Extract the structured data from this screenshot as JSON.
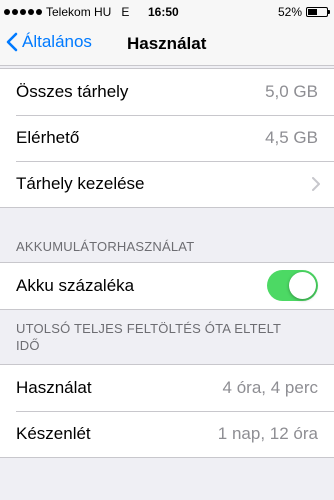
{
  "status_bar": {
    "carrier": "Telekom HU",
    "network": "E",
    "time": "16:50",
    "battery_percent": "52%",
    "battery_level": 0.52
  },
  "nav": {
    "back_label": "Általános",
    "title": "Használat"
  },
  "storage": {
    "rows": [
      {
        "label": "Összes tárhely",
        "value": "5,0 GB"
      },
      {
        "label": "Elérhető",
        "value": "4,5 GB"
      },
      {
        "label": "Tárhely kezelése"
      }
    ]
  },
  "battery": {
    "header": "AKKUMULÁTORHASZNÁLAT",
    "percent_label": "Akku százaléka",
    "percent_on": true
  },
  "charge": {
    "header": "UTOLSÓ TELJES FELTÖLTÉS ÓTA ELTELT IDŐ",
    "rows": [
      {
        "label": "Használat",
        "value": "4 óra, 4 perc"
      },
      {
        "label": "Készenlét",
        "value": "1 nap, 12 óra"
      }
    ]
  },
  "colors": {
    "accent": "#007aff",
    "toggle_on": "#4cd964",
    "background": "#efeff4"
  }
}
